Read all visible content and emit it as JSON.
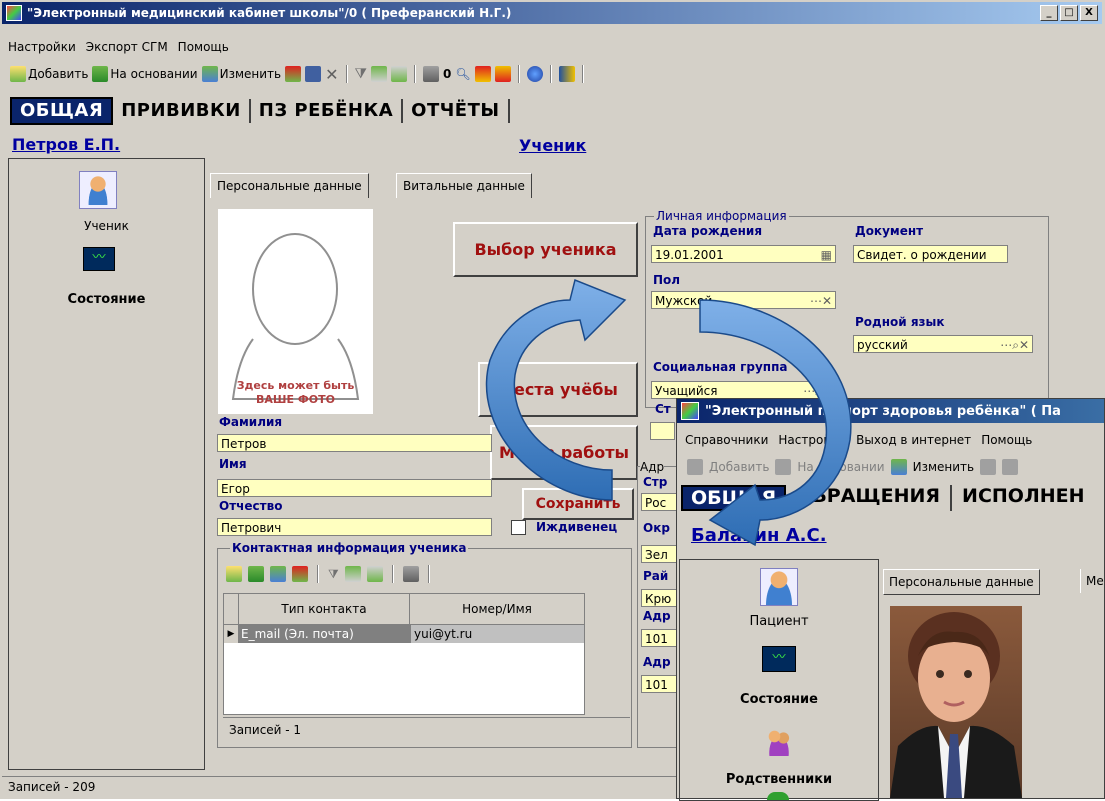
{
  "main_window": {
    "title": "\"Электронный медицинский кабинет школы\"/0 ( Преферанский Н.Г.)",
    "window_buttons": [
      "_",
      "□",
      "X"
    ],
    "menu": [
      "Настройки",
      "Экспорт СГМ",
      "Помощь"
    ],
    "toolbar": {
      "add": "Добавить",
      "based_on": "На основании",
      "edit": "Изменить"
    },
    "tabs": [
      "ОБЩАЯ",
      "ПРИВИВКИ",
      "ПЗ РЕБЁНКА",
      "ОТЧЁТЫ"
    ],
    "person_link": "Петров Е.П.",
    "section_title": "Ученик",
    "sidebar": [
      {
        "label": "Ученик",
        "icon": "student-icon"
      },
      {
        "label": "Состояние",
        "icon": "state-monitor-icon"
      }
    ],
    "inner_tabs": [
      "Персональные данные",
      "Витальные данные"
    ],
    "photo_caption_1": "Здесь может быть",
    "photo_caption_2": "ВАШЕ ФОТО",
    "buttons": {
      "select_student": "Выбор ученика",
      "study_places": "Места учёбы",
      "work_places": "Места работы",
      "save": "Сохранить"
    },
    "form": {
      "surname_label": "Фамилия",
      "surname_value": "Петров",
      "name_label": "Имя",
      "name_value": "Егор",
      "patronymic_label": "Отчество",
      "patronymic_value": "Петрович",
      "dependent_label": "Иждивенец"
    },
    "personal_info": {
      "group_title": "Личная информация",
      "birth_label": "Дата рождения",
      "birth_value": "19.01.2001",
      "document_label": "Документ",
      "document_value": "Свидет. о рождении",
      "sex_label": "Пол",
      "sex_value": "Мужской",
      "language_label": "Родной язык",
      "language_value": "русский",
      "social_label": "Социальная группа",
      "social_value": "Учащийся",
      "st_label": "Ст"
    },
    "address": {
      "group_title": "Адр",
      "labels": [
        "Стр",
        "Окр",
        "Рай",
        "Адр",
        "Адр"
      ],
      "values": [
        "Рос",
        "Зел",
        "Крю",
        "101",
        "101"
      ]
    },
    "contacts": {
      "group_title": "Контактная информация ученика",
      "columns": [
        "Тип контакта",
        "Номер/Имя"
      ],
      "rows": [
        [
          "E_mail (Эл. почта)",
          "yui@yt.ru"
        ]
      ],
      "footer": "Записей - 1"
    },
    "status_bar": "Записей - 209"
  },
  "second_window": {
    "title": "\"Электронный паспорт здоровья ребёнка\" ( Па",
    "menu": [
      "Справочники",
      "Настройки",
      "Выход в интернет",
      "Помощь"
    ],
    "toolbar": {
      "add": "Добавить",
      "based_on": "На основании",
      "edit": "Изменить"
    },
    "tabs": [
      "ОБЩАЯ",
      "ОБРАЩЕНИЯ",
      "ИСПОЛНЕН"
    ],
    "person_link": "Балакин А.С.",
    "sidebar": [
      {
        "label": "Пациент",
        "icon": "patient-icon"
      },
      {
        "label": "Состояние",
        "icon": "state-monitor-icon"
      },
      {
        "label": "Родственники",
        "icon": "relatives-icon"
      }
    ],
    "inner_tabs": [
      "Персональные данные",
      "Ме"
    ]
  },
  "colors": {
    "title_bar": "#0a246a",
    "field_bg": "#ffffc0",
    "label_blue": "#000080",
    "button_red": "#a01010",
    "arrow_blue": "#2e6db4"
  }
}
